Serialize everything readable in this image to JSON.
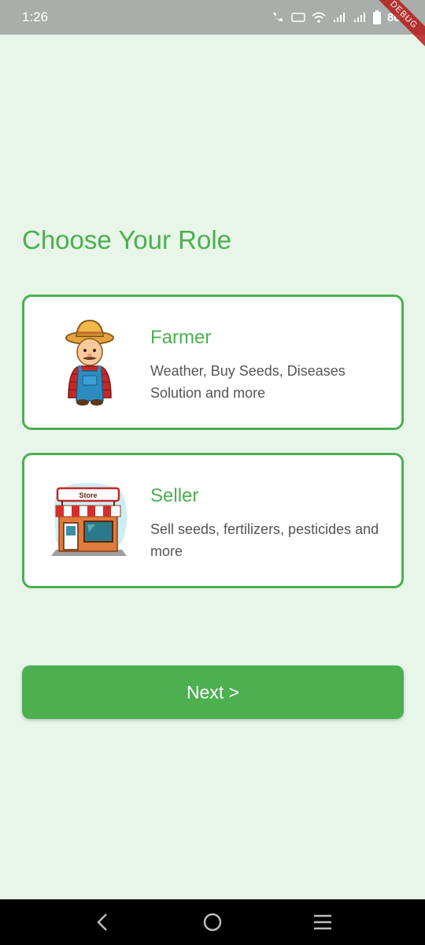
{
  "status_bar": {
    "time": "1:26",
    "battery": "80%",
    "debug_label": "DEBUG"
  },
  "page": {
    "title": "Choose Your Role"
  },
  "roles": [
    {
      "title": "Farmer",
      "description": "Weather, Buy Seeds, Diseases Solution and more",
      "icon": "farmer-illustration"
    },
    {
      "title": "Seller",
      "description": "Sell seeds, fertilizers, pesticides and more",
      "icon": "store-illustration",
      "store_sign": "Store"
    }
  ],
  "next_button": {
    "label": "Next >"
  },
  "colors": {
    "accent": "#4caf50",
    "background": "#e8f5e9",
    "card": "#ffffff",
    "description_text": "#555555"
  },
  "nav_bar": {
    "icons": [
      "back-icon",
      "home-icon",
      "menu-icon"
    ]
  }
}
